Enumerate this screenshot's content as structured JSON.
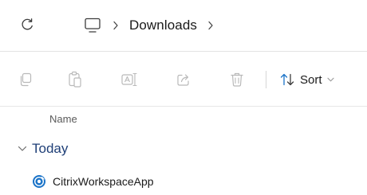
{
  "addressbar": {
    "breadcrumbs": [
      {
        "label": "Downloads"
      }
    ]
  },
  "toolbar": {
    "icons": [
      "copy-icon",
      "paste-icon",
      "rename-icon",
      "share-icon",
      "delete-icon"
    ],
    "sort_label": "Sort"
  },
  "file_list": {
    "column_name": "Name",
    "group": {
      "label": "Today"
    },
    "files": [
      {
        "name": "CitrixWorkspaceApp",
        "icon": "citrix-app-icon"
      }
    ]
  },
  "colors": {
    "accent": "#1a73c8",
    "disabled_icon": "#b9b9b9",
    "group_text": "#1f3f77"
  }
}
